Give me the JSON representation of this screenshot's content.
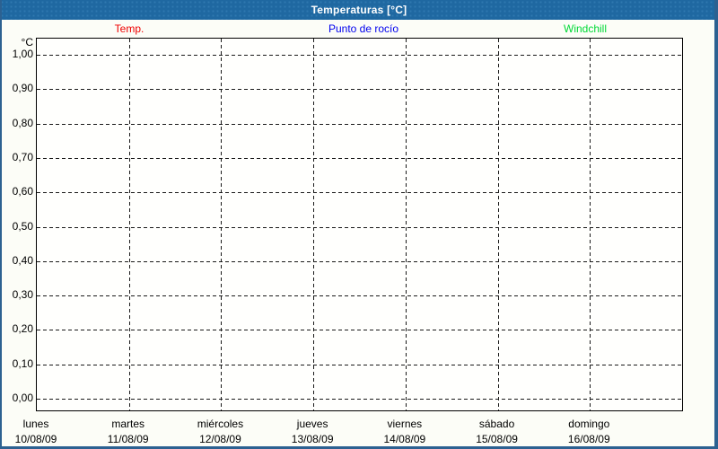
{
  "window": {
    "title": "Temperaturas [°C]"
  },
  "legend": [
    {
      "label": "Temp.",
      "color": "#ee0000"
    },
    {
      "label": "Punto de rocío",
      "color": "#0000ee"
    },
    {
      "label": "Windchill",
      "color": "#00d936"
    }
  ],
  "colors": {
    "titlebar": "#1f68a1",
    "frame": "#2c6191",
    "gridline": "#1a1a1a",
    "plot_background": "#fffffd",
    "page_background": "#fcfdf7"
  },
  "chart_data": {
    "type": "line",
    "title": "Temperaturas [°C]",
    "ylabel": "°C",
    "xlabel": "",
    "ylim": [
      0,
      1
    ],
    "grid": true,
    "legend_position": "top",
    "yticks": [
      {
        "value": 1.0,
        "label": "1,00"
      },
      {
        "value": 0.9,
        "label": "0,90"
      },
      {
        "value": 0.8,
        "label": "0,80"
      },
      {
        "value": 0.7,
        "label": "0,70"
      },
      {
        "value": 0.6,
        "label": "0,60"
      },
      {
        "value": 0.5,
        "label": "0,50"
      },
      {
        "value": 0.4,
        "label": "0,40"
      },
      {
        "value": 0.3,
        "label": "0,30"
      },
      {
        "value": 0.2,
        "label": "0,20"
      },
      {
        "value": 0.1,
        "label": "0,10"
      },
      {
        "value": 0.0,
        "label": "0,00"
      }
    ],
    "categories": [
      {
        "day": "lunes",
        "date": "10/08/09"
      },
      {
        "day": "martes",
        "date": "11/08/09"
      },
      {
        "day": "miércoles",
        "date": "12/08/09"
      },
      {
        "day": "jueves",
        "date": "13/08/09"
      },
      {
        "day": "viernes",
        "date": "14/08/09"
      },
      {
        "day": "sábado",
        "date": "15/08/09"
      },
      {
        "day": "domingo",
        "date": "16/08/09"
      }
    ],
    "series": [
      {
        "name": "Temp.",
        "color": "#ee0000",
        "values": []
      },
      {
        "name": "Punto de rocío",
        "color": "#0000ee",
        "values": []
      },
      {
        "name": "Windchill",
        "color": "#00d936",
        "values": []
      }
    ]
  }
}
